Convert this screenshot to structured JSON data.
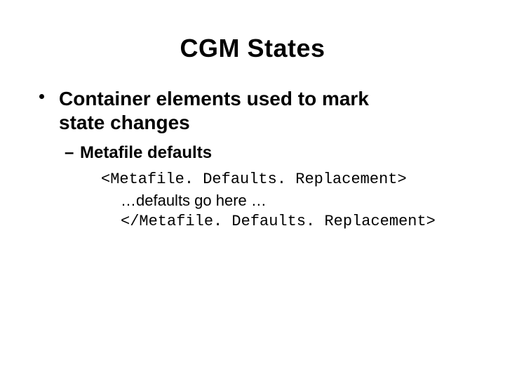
{
  "title": "CGM States",
  "bullet1_line1": "Container elements used to mark",
  "bullet1_line2": "state changes",
  "bullet2": "Metafile defaults",
  "code": {
    "open_tag": "<Metafile. Defaults. Replacement>",
    "body": "…defaults go here …",
    "close_tag": "</Metafile. Defaults. Replacement>"
  }
}
